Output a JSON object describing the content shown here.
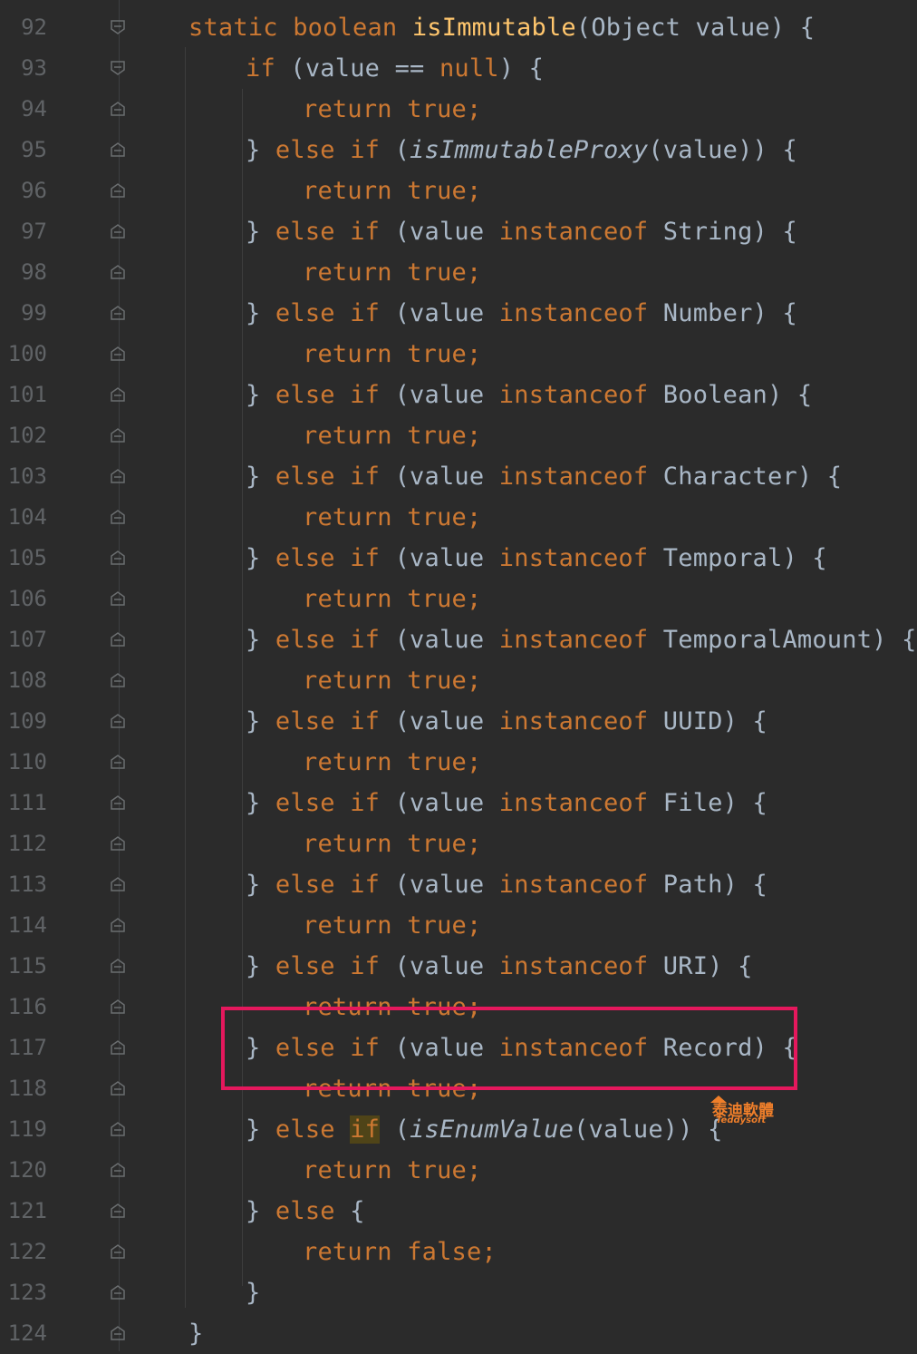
{
  "editor": {
    "lines": [
      {
        "number": "92",
        "tokens": [
          {
            "t": "static boolean ",
            "c": "kw"
          },
          {
            "t": "isImmutable",
            "c": "fn"
          },
          {
            "t": "(Object value) {",
            "c": "p"
          }
        ]
      },
      {
        "number": "93",
        "tokens": [
          {
            "t": "if",
            "c": "kw"
          },
          {
            "t": " (value == ",
            "c": "p"
          },
          {
            "t": "null",
            "c": "kw"
          },
          {
            "t": ") {",
            "c": "p"
          }
        ]
      },
      {
        "number": "94",
        "tokens": [
          {
            "t": "return true;",
            "c": "kw"
          }
        ]
      },
      {
        "number": "95",
        "tokens": [
          {
            "t": "} ",
            "c": "p"
          },
          {
            "t": "else if",
            "c": "kw"
          },
          {
            "t": " (",
            "c": "p"
          },
          {
            "t": "isImmutableProxy",
            "c": "it"
          },
          {
            "t": "(value)) {",
            "c": "p"
          }
        ]
      },
      {
        "number": "96",
        "tokens": [
          {
            "t": "return true;",
            "c": "kw"
          }
        ]
      },
      {
        "number": "97",
        "tokens": [
          {
            "t": "} ",
            "c": "p"
          },
          {
            "t": "else if",
            "c": "kw"
          },
          {
            "t": " (value ",
            "c": "p"
          },
          {
            "t": "instanceof",
            "c": "kw"
          },
          {
            "t": " String) {",
            "c": "p"
          }
        ]
      },
      {
        "number": "98",
        "tokens": [
          {
            "t": "return true;",
            "c": "kw"
          }
        ]
      },
      {
        "number": "99",
        "tokens": [
          {
            "t": "} ",
            "c": "p"
          },
          {
            "t": "else if",
            "c": "kw"
          },
          {
            "t": " (value ",
            "c": "p"
          },
          {
            "t": "instanceof",
            "c": "kw"
          },
          {
            "t": " Number) {",
            "c": "p"
          }
        ]
      },
      {
        "number": "100",
        "tokens": [
          {
            "t": "return true;",
            "c": "kw"
          }
        ]
      },
      {
        "number": "101",
        "tokens": [
          {
            "t": "} ",
            "c": "p"
          },
          {
            "t": "else if",
            "c": "kw"
          },
          {
            "t": " (value ",
            "c": "p"
          },
          {
            "t": "instanceof",
            "c": "kw"
          },
          {
            "t": " Boolean) {",
            "c": "p"
          }
        ]
      },
      {
        "number": "102",
        "tokens": [
          {
            "t": "return true;",
            "c": "kw"
          }
        ]
      },
      {
        "number": "103",
        "tokens": [
          {
            "t": "} ",
            "c": "p"
          },
          {
            "t": "else if",
            "c": "kw"
          },
          {
            "t": " (value ",
            "c": "p"
          },
          {
            "t": "instanceof",
            "c": "kw"
          },
          {
            "t": " Character) {",
            "c": "p"
          }
        ]
      },
      {
        "number": "104",
        "tokens": [
          {
            "t": "return true;",
            "c": "kw"
          }
        ]
      },
      {
        "number": "105",
        "tokens": [
          {
            "t": "} ",
            "c": "p"
          },
          {
            "t": "else if",
            "c": "kw"
          },
          {
            "t": " (value ",
            "c": "p"
          },
          {
            "t": "instanceof",
            "c": "kw"
          },
          {
            "t": " Temporal) {",
            "c": "p"
          }
        ]
      },
      {
        "number": "106",
        "tokens": [
          {
            "t": "return true;",
            "c": "kw"
          }
        ]
      },
      {
        "number": "107",
        "tokens": [
          {
            "t": "} ",
            "c": "p"
          },
          {
            "t": "else if",
            "c": "kw"
          },
          {
            "t": " (value ",
            "c": "p"
          },
          {
            "t": "instanceof",
            "c": "kw"
          },
          {
            "t": " TemporalAmount) {",
            "c": "p"
          }
        ]
      },
      {
        "number": "108",
        "tokens": [
          {
            "t": "return true;",
            "c": "kw"
          }
        ]
      },
      {
        "number": "109",
        "tokens": [
          {
            "t": "} ",
            "c": "p"
          },
          {
            "t": "else if",
            "c": "kw"
          },
          {
            "t": " (value ",
            "c": "p"
          },
          {
            "t": "instanceof",
            "c": "kw"
          },
          {
            "t": " UUID) {",
            "c": "p"
          }
        ]
      },
      {
        "number": "110",
        "tokens": [
          {
            "t": "return true;",
            "c": "kw"
          }
        ]
      },
      {
        "number": "111",
        "tokens": [
          {
            "t": "} ",
            "c": "p"
          },
          {
            "t": "else if",
            "c": "kw"
          },
          {
            "t": " (value ",
            "c": "p"
          },
          {
            "t": "instanceof",
            "c": "kw"
          },
          {
            "t": " File) {",
            "c": "p"
          }
        ]
      },
      {
        "number": "112",
        "tokens": [
          {
            "t": "return true;",
            "c": "kw"
          }
        ]
      },
      {
        "number": "113",
        "tokens": [
          {
            "t": "} ",
            "c": "p"
          },
          {
            "t": "else if",
            "c": "kw"
          },
          {
            "t": " (value ",
            "c": "p"
          },
          {
            "t": "instanceof",
            "c": "kw"
          },
          {
            "t": " Path) {",
            "c": "p"
          }
        ]
      },
      {
        "number": "114",
        "tokens": [
          {
            "t": "return true;",
            "c": "kw"
          }
        ]
      },
      {
        "number": "115",
        "tokens": [
          {
            "t": "} ",
            "c": "p"
          },
          {
            "t": "else if",
            "c": "kw"
          },
          {
            "t": " (value ",
            "c": "p"
          },
          {
            "t": "instanceof",
            "c": "kw"
          },
          {
            "t": " URI) {",
            "c": "p"
          }
        ]
      },
      {
        "number": "116",
        "tokens": [
          {
            "t": "return true;",
            "c": "kw"
          }
        ]
      },
      {
        "number": "117",
        "tokens": [
          {
            "t": "} ",
            "c": "p"
          },
          {
            "t": "else if",
            "c": "kw"
          },
          {
            "t": " (value ",
            "c": "p"
          },
          {
            "t": "instanceof",
            "c": "kw"
          },
          {
            "t": " Record) {",
            "c": "p"
          }
        ]
      },
      {
        "number": "118",
        "tokens": [
          {
            "t": "return true;",
            "c": "kw"
          }
        ]
      },
      {
        "number": "119",
        "tokens": [
          {
            "t": "} ",
            "c": "p"
          },
          {
            "t": "else ",
            "c": "kw"
          },
          {
            "t": "if",
            "c": "kw hl"
          },
          {
            "t": " (",
            "c": "p"
          },
          {
            "t": "isEnumValue",
            "c": "it"
          },
          {
            "t": "(value)) {",
            "c": "p"
          }
        ]
      },
      {
        "number": "120",
        "tokens": [
          {
            "t": "return true;",
            "c": "kw"
          }
        ]
      },
      {
        "number": "121",
        "tokens": [
          {
            "t": "} ",
            "c": "p"
          },
          {
            "t": "else",
            "c": "kw"
          },
          {
            "t": " {",
            "c": "p"
          }
        ]
      },
      {
        "number": "122",
        "tokens": [
          {
            "t": "return false;",
            "c": "kw"
          }
        ]
      },
      {
        "number": "123",
        "tokens": [
          {
            "t": "}",
            "c": "p"
          }
        ]
      },
      {
        "number": "124",
        "tokens": [
          {
            "t": "}",
            "c": "p"
          }
        ]
      }
    ]
  },
  "watermark": {
    "title": "泰迪軟體",
    "subtitle": "Teddysoft"
  },
  "colors": {
    "background": "#2b2b2b",
    "keyword": "#cc7832",
    "method": "#ffc66d",
    "plain": "#a9b7c6",
    "line_number": "#606366",
    "highlight_box": "#e5185d"
  }
}
